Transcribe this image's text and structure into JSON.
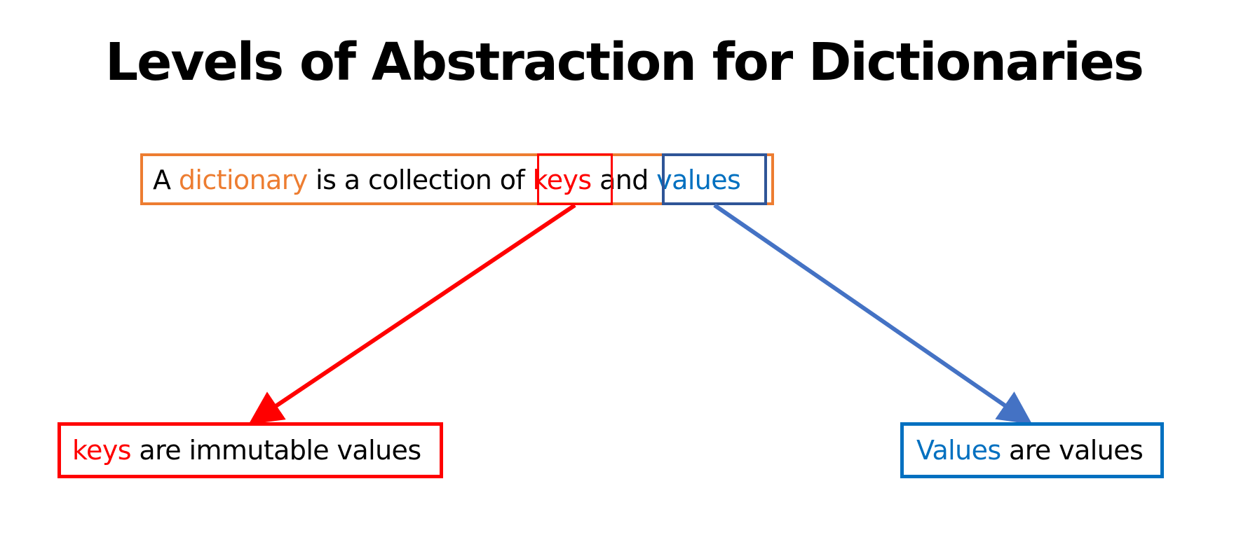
{
  "title": "Levels of Abstraction for Dictionaries",
  "main_statement": {
    "w1": "A",
    "w2": "dictionary",
    "w3": "is a collection of",
    "w4": "keys",
    "w5": "and",
    "w6": "values"
  },
  "left_node": {
    "highlight": "keys",
    "rest": "are immutable values"
  },
  "right_node": {
    "highlight": "Values",
    "rest": "are values"
  },
  "colors": {
    "orange": "#ed7d31",
    "red": "#ff0000",
    "blue_text": "#0070c0",
    "blue_arrow": "#4472c4",
    "navy_box": "#2f5597"
  }
}
